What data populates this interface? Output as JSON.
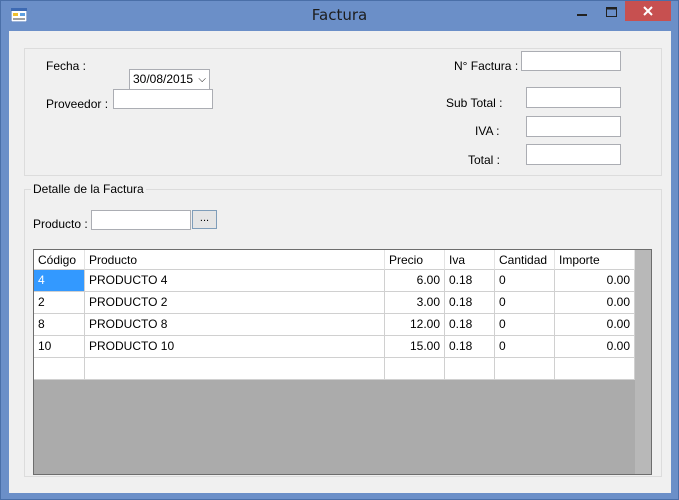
{
  "window": {
    "title": "Factura"
  },
  "header_group": {
    "fecha_label": "Fecha :",
    "fecha_value": "30/08/2015",
    "proveedor_label": "Proveedor :",
    "proveedor_value": "",
    "nro_factura_label": "N° Factura :",
    "nro_factura_value": "",
    "subtotal_label": "Sub Total :",
    "subtotal_value": "",
    "iva_label": "IVA :",
    "iva_value": "",
    "total_label": "Total :",
    "total_value": ""
  },
  "detail_group": {
    "title": "Detalle de la Factura",
    "producto_label": "Producto :",
    "producto_value": "",
    "browse_label": "..."
  },
  "grid": {
    "columns": [
      "Código",
      "Producto",
      "Precio",
      "Iva",
      "Cantidad",
      "Importe"
    ],
    "rows": [
      [
        "4",
        "PRODUCTO 4",
        "6.00",
        "0.18",
        "0",
        "0.00"
      ],
      [
        "2",
        "PRODUCTO 2",
        "3.00",
        "0.18",
        "0",
        "0.00"
      ],
      [
        "8",
        "PRODUCTO 8",
        "12.00",
        "0.18",
        "0",
        "0.00"
      ],
      [
        "10",
        "PRODUCTO 10",
        "15.00",
        "0.18",
        "0",
        "0.00"
      ],
      [
        "",
        "",
        "",
        "",
        "",
        ""
      ]
    ]
  }
}
